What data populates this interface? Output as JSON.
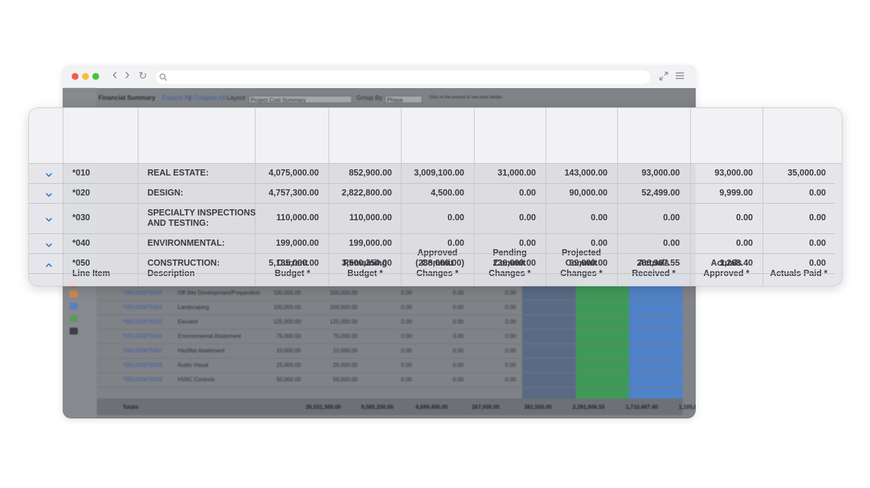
{
  "browser": {
    "nav_back": "‹",
    "nav_forward": "›",
    "nav_reload": "↻",
    "url": ""
  },
  "app_toolbar": {
    "title": "Financial Summary",
    "expand_all": "Expand All",
    "separator": "|",
    "collapse_all": "Collapse All",
    "layout_label": "Layout",
    "layout_value": "Project Cost Summary",
    "group_by_label": "Group By",
    "group_by_value": "Phase",
    "hint": "Click on the amount to see more details"
  },
  "background_rows": [
    {
      "code": "*050.0000*5003",
      "desc": "Off-Site Development/Preparation",
      "v1": "100,000.00",
      "v2": "100,000.00",
      "v3": "0.00",
      "v4": "0.00",
      "v5": "0.00"
    },
    {
      "code": "*050.0000*5004",
      "desc": "Landscaping",
      "v1": "100,000.00",
      "v2": "100,000.00",
      "v3": "0.00",
      "v4": "0.00",
      "v5": "0.00"
    },
    {
      "code": "*050.0000*5005",
      "desc": "Elevator",
      "v1": "125,000.00",
      "v2": "125,000.00",
      "v3": "0.00",
      "v4": "0.00",
      "v5": "0.00"
    },
    {
      "code": "*050.0000*5006",
      "desc": "Environmental Abatement",
      "v1": "75,000.00",
      "v2": "75,000.00",
      "v3": "0.00",
      "v4": "0.00",
      "v5": "0.00"
    },
    {
      "code": "*050.0000*5007",
      "desc": "HazMat Abatement",
      "v1": "10,000.00",
      "v2": "10,000.00",
      "v3": "0.00",
      "v4": "0.00",
      "v5": "0.00"
    },
    {
      "code": "*050.0000*5008",
      "desc": "Audio Visual",
      "v1": "25,000.00",
      "v2": "25,000.00",
      "v3": "0.00",
      "v4": "0.00",
      "v5": "0.00"
    },
    {
      "code": "*050.0000*5009",
      "desc": "HVAC Controls",
      "v1": "50,000.00",
      "v2": "50,000.00",
      "v3": "0.00",
      "v4": "0.00",
      "v5": "0.00"
    }
  ],
  "background_totals": {
    "label": "Totals",
    "values": [
      "26,531,300.00",
      "9,585,250.00",
      "4,699,400.00",
      "267,000.00",
      "381,500.00",
      "2,391,806.55",
      "1,710,467.40",
      "1,105,000.00"
    ]
  },
  "table": {
    "headers": {
      "line_item": "Line Item",
      "description": "Description",
      "current_budget": [
        "Current",
        "Budget *"
      ],
      "remaining_budget": [
        "Remaining",
        "Budget *"
      ],
      "approved_commit": [
        "Approved",
        "Commit",
        "Changes *"
      ],
      "pending_commit": [
        "Pending",
        "Commit",
        "Changes *"
      ],
      "projected_commit": [
        "Projected",
        "Commit",
        "Changes *"
      ],
      "actuals_received": [
        "Actuals",
        "Received *"
      ],
      "actuals_approved": [
        "Actuals",
        "Approved *"
      ],
      "actuals_paid": "Actuals Paid *"
    },
    "rows": [
      {
        "expanded": false,
        "line_item": "*010",
        "description": [
          "REAL ESTATE:"
        ],
        "current_budget": "4,075,000.00",
        "remaining_budget": "852,900.00",
        "approved_commit": "3,009,100.00",
        "pending_commit": "31,000.00",
        "projected_commit": "143,000.00",
        "actuals_received": "93,000.00",
        "actuals_approved": "93,000.00",
        "actuals_paid": "35,000.00"
      },
      {
        "expanded": false,
        "line_item": "*020",
        "description": [
          "DESIGN:"
        ],
        "current_budget": "4,757,300.00",
        "remaining_budget": "2,822,800.00",
        "approved_commit": "4,500.00",
        "pending_commit": "0.00",
        "projected_commit": "90,000.00",
        "actuals_received": "52,499.00",
        "actuals_approved": "9,999.00",
        "actuals_paid": "0.00"
      },
      {
        "expanded": false,
        "line_item": "*030",
        "description": [
          "SPECIALTY INSPECTIONS",
          "AND TESTING:"
        ],
        "current_budget": "110,000.00",
        "remaining_budget": "110,000.00",
        "approved_commit": "0.00",
        "pending_commit": "0.00",
        "projected_commit": "0.00",
        "actuals_received": "0.00",
        "actuals_approved": "0.00",
        "actuals_paid": "0.00"
      },
      {
        "expanded": false,
        "line_item": "*040",
        "description": [
          "ENVIRONMENTAL:"
        ],
        "current_budget": "199,000.00",
        "remaining_budget": "199,000.00",
        "approved_commit": "0.00",
        "pending_commit": "0.00",
        "projected_commit": "0.00",
        "actuals_received": "0.00",
        "actuals_approved": "0.00",
        "actuals_paid": "0.00"
      },
      {
        "expanded": true,
        "line_item": "*050",
        "description": [
          "CONSTRUCTION:"
        ],
        "current_budget": "5,185,000.00",
        "remaining_budget": "3,500,350.00",
        "approved_commit": "(288,000.00)",
        "pending_commit": "236,000.00",
        "projected_commit": "69,000.00",
        "actuals_received": "286,907.55",
        "actuals_approved": "1,268.40",
        "actuals_paid": "0.00"
      }
    ]
  },
  "colors": {
    "accent_chevron": "#2f7fd0",
    "link_blue": "#3d5fa3"
  }
}
